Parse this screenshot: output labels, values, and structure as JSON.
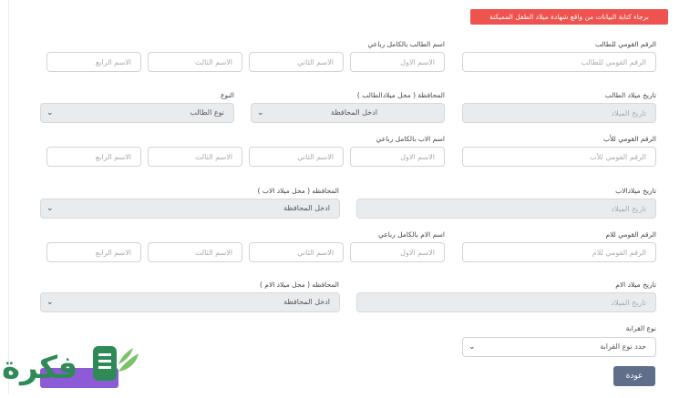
{
  "notice": "برجاء كتابة البيانات من واقع شهادة ميلاد الطفل المميكنة",
  "student": {
    "national_id_label": "الرقم القومي للطالب",
    "national_id_placeholder": "الرقم القومي للطالب",
    "fullname_label": "اسم الطالب بالكامل رباعي",
    "first_placeholder": "الاسم الاول",
    "second_placeholder": "الاسم الثاني",
    "third_placeholder": "الاسم الثالث",
    "fourth_placeholder": "الاسم الرابع",
    "birthdate_label": "تاريخ ميلاد الطالب",
    "birthdate_placeholder": "تاريخ الميلاد",
    "governorate_label": "المحافظة ( محل ميلادالطالب )",
    "governorate_value": "ادخل المحافظة",
    "gender_label": "النوع",
    "gender_value": "نوع الطالب"
  },
  "father": {
    "national_id_label": "الرقم القومي للأب",
    "national_id_placeholder": "الرقم القومي للأب",
    "fullname_label": "اسم الاب بالكامل رباعي",
    "first_placeholder": "الاسم الاول",
    "second_placeholder": "الاسم الثاني",
    "third_placeholder": "الاسم الثالث",
    "fourth_placeholder": "الاسم الرابع",
    "birthdate_label": "تاريخ ميلادالاب",
    "birthdate_placeholder": "تاريخ الميلاد",
    "governorate_label": "المحافظه ( محل ميلاد الاب )",
    "governorate_value": "ادخل المحافظة"
  },
  "mother": {
    "national_id_label": "الرقم القومي للام",
    "national_id_placeholder": "الرقم القومي للام",
    "fullname_label": "اسم الام بالكامل رباعي",
    "first_placeholder": "الاسم الاول",
    "second_placeholder": "الاسم الثاني",
    "third_placeholder": "الاسم الثالث",
    "fourth_placeholder": "الاسم الرابع",
    "birthdate_label": "تاريخ ميلاد الام",
    "birthdate_placeholder": "تاريخ الميلاد",
    "governorate_label": "المحافظه ( محل ميلاد الام )",
    "governorate_value": "ادخل المحافظة"
  },
  "relation": {
    "label": "نوع القرابة",
    "value": "حدد نوع القرابة"
  },
  "buttons": {
    "back": "عودة"
  },
  "logo": {
    "text": "فكرة"
  },
  "colors": {
    "notice": "#ef5350",
    "back_button": "#5f6f8a",
    "next_button": "#8d5bd6",
    "logo": "#2e8b57"
  },
  "icons": {
    "dropdown": "chevron-down-icon"
  }
}
